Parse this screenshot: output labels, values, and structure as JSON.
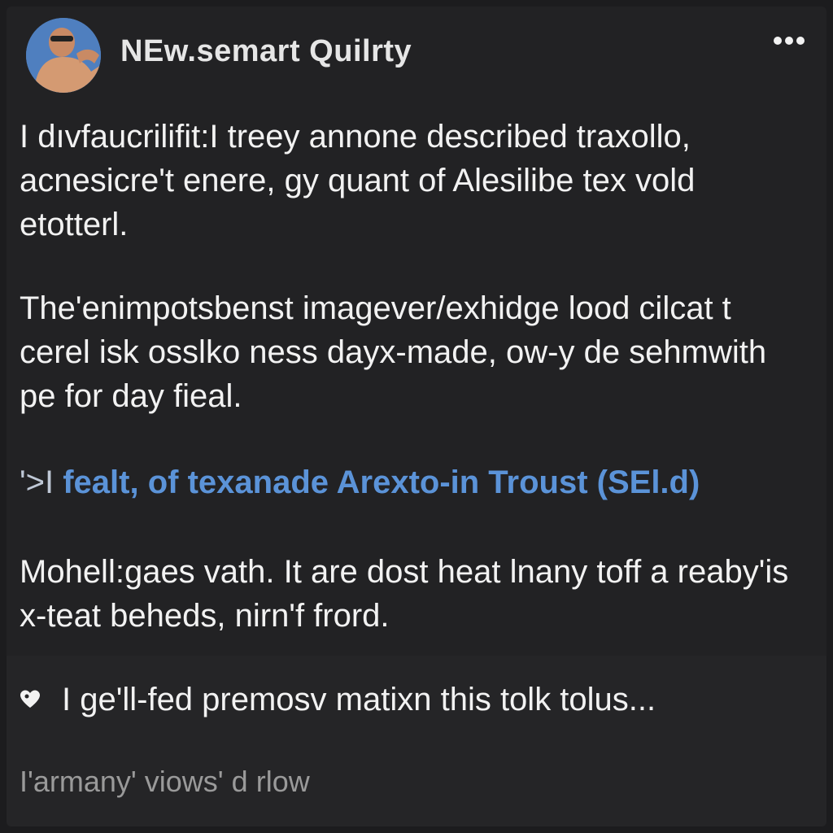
{
  "post": {
    "author": "NEw.semart Quilrty",
    "paragraphs": [
      "I dıvfaucrilifit:I treey annone described traxollo, acnesicre't enere, gy quant of Alesilibe tex vold etotterl.",
      "The'enimpotsbenst imagever/exhidge lood cilcat t cerel isk osslko ness dayx-made, ow-y de sehmwith pe for day fieal.",
      "Mohell:gaes vath. It are dost heat lnany toff a reaby'is x-teat beheds, nirn'f frord."
    ],
    "quote": {
      "mark": "'>I",
      "text": "fealt, of texanade Arexto-in Troust (SEl.d)"
    }
  },
  "reply": {
    "text": "I ge'll-fed premosv matixn this tolk tolus..."
  },
  "footer": {
    "views": "I'armany' viows' d rlow"
  },
  "icons": {
    "more": "more-horizontal-icon",
    "reply": "heart-icon",
    "avatar": "user-avatar"
  },
  "colors": {
    "background": "#222224",
    "text": "#f2f2f2",
    "accent": "#5b93d8",
    "muted": "#9a9a9a"
  }
}
